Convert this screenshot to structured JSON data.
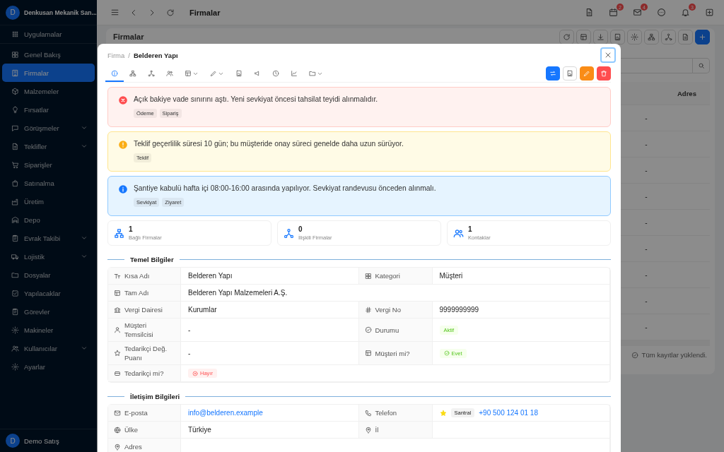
{
  "sidebar": {
    "avatar": "D",
    "company": "Denkusan Mekanik San...",
    "items": [
      {
        "kind": "apps",
        "label": "Uygulamalar",
        "selected": false,
        "expandable": false
      },
      {
        "kind": "overview",
        "label": "Genel Bakış",
        "selected": false,
        "expandable": false
      },
      {
        "kind": "companies",
        "label": "Firmalar",
        "selected": true,
        "expandable": false
      },
      {
        "kind": "materials",
        "label": "Malzemeler",
        "selected": false,
        "expandable": false
      },
      {
        "kind": "opportunities",
        "label": "Fırsatlar",
        "selected": false,
        "expandable": false
      },
      {
        "kind": "meetings",
        "label": "Görüşmeler",
        "selected": false,
        "expandable": true
      },
      {
        "kind": "quotes",
        "label": "Teklifler",
        "selected": false,
        "expandable": true
      },
      {
        "kind": "orders",
        "label": "Siparişler",
        "selected": false,
        "expandable": false
      },
      {
        "kind": "purchasing",
        "label": "Satınalma",
        "selected": false,
        "expandable": false
      },
      {
        "kind": "production",
        "label": "Üretim",
        "selected": false,
        "expandable": false
      },
      {
        "kind": "warehouse",
        "label": "Depo",
        "selected": false,
        "expandable": false
      },
      {
        "kind": "documents",
        "label": "Evrak Takibi",
        "selected": false,
        "expandable": true
      },
      {
        "kind": "logistics",
        "label": "Lojistik",
        "selected": false,
        "expandable": true
      },
      {
        "kind": "files",
        "label": "Dosyalar",
        "selected": false,
        "expandable": false
      },
      {
        "kind": "todos",
        "label": "Yapılacaklar",
        "selected": false,
        "expandable": false
      },
      {
        "kind": "tasks",
        "label": "Görevler",
        "selected": false,
        "expandable": false
      },
      {
        "kind": "machines",
        "label": "Makineler",
        "selected": false,
        "expandable": false
      },
      {
        "kind": "users",
        "label": "Kullanıcılar",
        "selected": false,
        "expandable": true
      },
      {
        "kind": "settings",
        "label": "Ayarlar",
        "selected": false,
        "expandable": false
      }
    ],
    "user": {
      "avatar": "D",
      "name": "Demo Satış"
    }
  },
  "topbar": {
    "title": "Firmalar",
    "actions": [
      {
        "kind": "file"
      },
      {
        "kind": "calendar",
        "badge": "2"
      },
      {
        "kind": "mail",
        "badge": "4"
      },
      {
        "kind": "chat"
      },
      {
        "kind": "bell",
        "badge": "3"
      },
      {
        "kind": "add"
      }
    ]
  },
  "page": {
    "title": "Firmalar",
    "toolbar": [
      {
        "kind": "refresh"
      },
      {
        "kind": "columns"
      },
      {
        "kind": "download"
      },
      {
        "kind": "report"
      },
      {
        "kind": "settings"
      },
      {
        "kind": "hierarchy"
      },
      {
        "kind": "network"
      },
      {
        "kind": "document"
      },
      {
        "kind": "add"
      }
    ],
    "table": {
      "columns": [
        "Adres"
      ],
      "rows": [
        {
          "column_1": "-"
        },
        {
          "column_1": "-"
        },
        {
          "column_1": "-"
        },
        {
          "column_1": "-"
        },
        {
          "column_1": "-"
        },
        {
          "column_1": "-"
        },
        {
          "column_1": "-"
        },
        {
          "column_1": "-"
        },
        {
          "column_1": "-"
        }
      ]
    },
    "footer": "Tüm kayıtlar yüklendi."
  },
  "modal": {
    "breadcrumb": {
      "parent": "Firma",
      "separator": "/",
      "current": "Belderen Yapı"
    },
    "tabs": [
      {
        "kind": "info",
        "selected": true,
        "dropdown": false
      },
      {
        "kind": "hierarchy",
        "selected": false,
        "dropdown": false
      },
      {
        "kind": "network",
        "selected": false,
        "dropdown": false
      },
      {
        "kind": "contacts",
        "selected": false,
        "dropdown": false
      },
      {
        "kind": "ledger",
        "selected": false,
        "dropdown": true
      },
      {
        "kind": "pen",
        "selected": false,
        "dropdown": true
      },
      {
        "kind": "report",
        "selected": false,
        "dropdown": false
      },
      {
        "kind": "campaign",
        "selected": false,
        "dropdown": false
      },
      {
        "kind": "history",
        "selected": false,
        "dropdown": false
      },
      {
        "kind": "chart",
        "selected": false,
        "dropdown": false
      },
      {
        "kind": "folder",
        "selected": false,
        "dropdown": true
      }
    ],
    "actions": [
      {
        "kind": "swap"
      },
      {
        "kind": "report"
      },
      {
        "kind": "edit"
      },
      {
        "kind": "delete"
      }
    ],
    "alerts": [
      {
        "kind": "error",
        "message": "Açık bakiye vade sınırını aştı. Yeni sevkiyat öncesi tahsilat teyidi alınmalıdır.",
        "tags": [
          "Ödeme",
          "Sipariş"
        ]
      },
      {
        "kind": "warning",
        "message": "Teklif geçerlilik süresi 10 gün; bu müşteride onay süreci genelde daha uzun sürüyor.",
        "tags": [
          "Teklif"
        ]
      },
      {
        "kind": "info",
        "message": "Şantiye kabulü hafta içi 08:00-16:00 arasında yapılıyor. Sevkiyat randevusu önceden alınmalı.",
        "tags": [
          "Sevkiyat",
          "Ziyaret"
        ]
      }
    ],
    "stats": [
      {
        "kind": "subsidiaries",
        "value": "1",
        "label": "Bağlı Firmalar"
      },
      {
        "kind": "related",
        "value": "0",
        "label": "İlişkili Firmalar"
      },
      {
        "kind": "contacts",
        "value": "1",
        "label": "Kontaklar"
      }
    ],
    "sections": [
      {
        "title": "Temel Bilgiler",
        "rows": [
          {
            "fields": [
              {
                "kind": "short-name",
                "label": "Kısa Adı",
                "value": "Belderen Yapı"
              },
              {
                "kind": "category",
                "label": "Kategori",
                "value": "Müşteri"
              }
            ]
          },
          {
            "fields": [
              {
                "kind": "full-name",
                "label": "Tam Adı",
                "value": "Belderen Yapı Malzemeleri A.Ş."
              }
            ]
          },
          {
            "fields": [
              {
                "kind": "tax-office",
                "label": "Vergi Dairesi",
                "value": "Kurumlar"
              },
              {
                "kind": "tax-number",
                "label": "Vergi No",
                "value": "9999999999"
              }
            ]
          },
          {
            "fields": [
              {
                "kind": "representative",
                "label": "Müşteri Temsilcisi",
                "value": "-"
              },
              {
                "kind": "status",
                "label": "Durumu",
                "value": "Aktif"
              }
            ]
          },
          {
            "fields": [
              {
                "kind": "rating",
                "label": "Tedarikçi Değ. Puanı",
                "value": "-"
              },
              {
                "kind": "is-customer",
                "label": "Müşteri mi?",
                "value": "Evet",
                "yes": true
              }
            ]
          },
          {
            "fields": [
              {
                "kind": "is-supplier",
                "label": "Tedarikçi mi?",
                "value": "Hayır",
                "yes": false
              }
            ]
          }
        ]
      },
      {
        "title": "İletişim Bilgileri",
        "rows": [
          {
            "fields": [
              {
                "kind": "email",
                "label": "E-posta",
                "value": "info@belderen.example"
              },
              {
                "kind": "phone",
                "label": "Telefon",
                "primary": true,
                "tag": "Santral",
                "value": "+90 500 124 01 18"
              }
            ]
          },
          {
            "fields": [
              {
                "kind": "country",
                "label": "Ülke",
                "value": "Türkiye"
              },
              {
                "kind": "city",
                "label": "İl"
              }
            ]
          },
          {
            "fields": [
              {
                "kind": "address",
                "label": "Adres"
              }
            ]
          }
        ]
      }
    ]
  }
}
